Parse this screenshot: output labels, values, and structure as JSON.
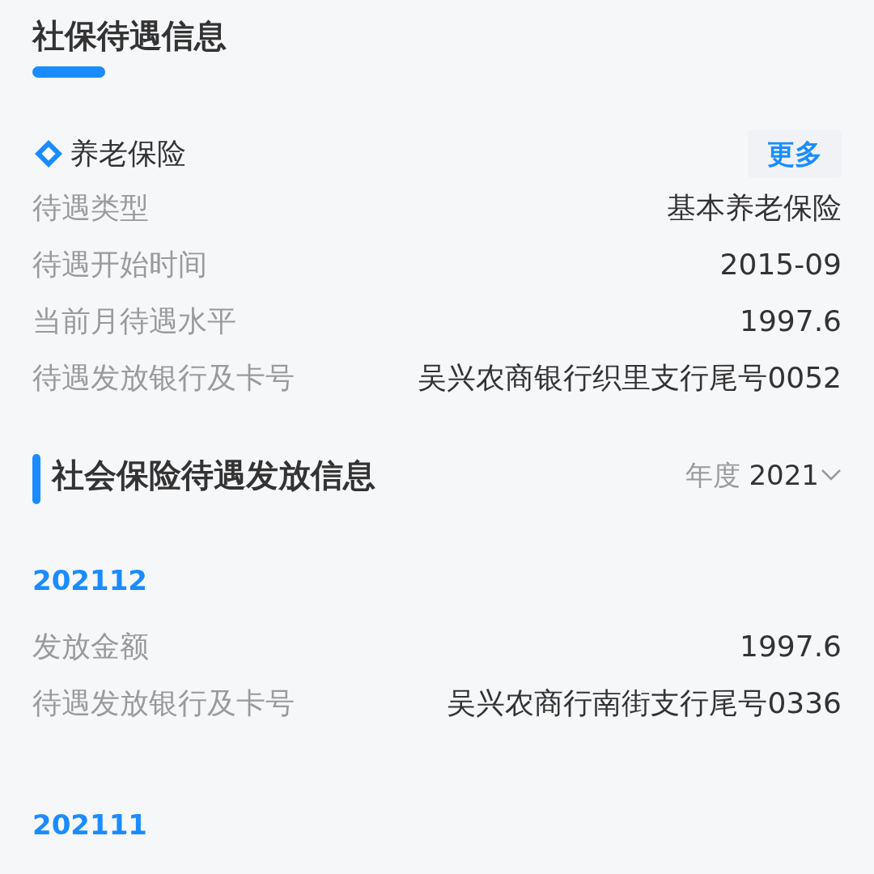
{
  "title": "社保待遇信息",
  "pension": {
    "name": "养老保险",
    "more": "更多",
    "rows": [
      {
        "label": "待遇类型",
        "value": "基本养老保险"
      },
      {
        "label": "待遇开始时间",
        "value": "2015-09"
      },
      {
        "label": "当前月待遇水平",
        "value": "1997.6"
      },
      {
        "label": "待遇发放银行及卡号",
        "value": "吴兴农商银行织里支行尾号0052"
      }
    ]
  },
  "payments": {
    "title": "社会保险待遇发放信息",
    "year_label": "年度",
    "year": "2021",
    "months": [
      {
        "month": "202112",
        "rows": [
          {
            "label": "发放金额",
            "value": "1997.6"
          },
          {
            "label": "待遇发放银行及卡号",
            "value": "吴兴农商行南街支行尾号0336"
          }
        ]
      },
      {
        "month": "202111"
      }
    ]
  }
}
